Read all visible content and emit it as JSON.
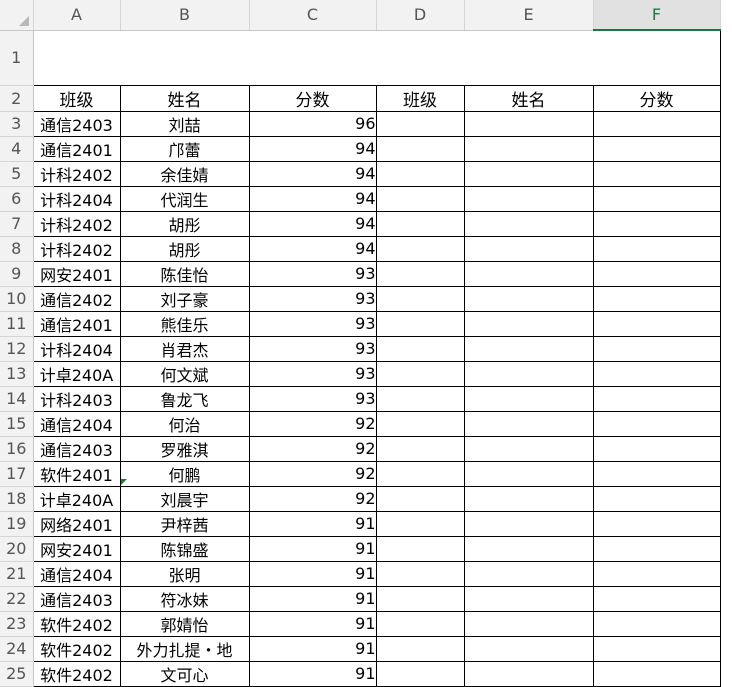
{
  "columns": [
    "A",
    "B",
    "C",
    "D",
    "E",
    "F"
  ],
  "row_numbers": [
    "1",
    "2",
    "3",
    "4",
    "5",
    "6",
    "7",
    "8",
    "9",
    "10",
    "11",
    "12",
    "13",
    "14",
    "15",
    "16",
    "17",
    "18",
    "19",
    "20",
    "21",
    "22",
    "23",
    "24",
    "25"
  ],
  "headers": {
    "class1": "班级",
    "name1": "姓名",
    "score1": "分数",
    "class2": "班级",
    "name2": "姓名",
    "score2": "分数"
  },
  "rows": [
    {
      "cls": "通信2403",
      "name": "刘喆",
      "score": "96"
    },
    {
      "cls": "通信2401",
      "name": "邝蕾",
      "score": "94"
    },
    {
      "cls": "计科2402",
      "name": "余佳婧",
      "score": "94"
    },
    {
      "cls": "计科2404",
      "name": "代润生",
      "score": "94"
    },
    {
      "cls": "计科2402",
      "name": "胡彤",
      "score": "94"
    },
    {
      "cls": "计科2402",
      "name": "胡彤",
      "score": "94"
    },
    {
      "cls": "网安2401",
      "name": "陈佳怡",
      "score": "93"
    },
    {
      "cls": "通信2402",
      "name": "刘子豪",
      "score": "93"
    },
    {
      "cls": "通信2401",
      "name": "熊佳乐",
      "score": "93"
    },
    {
      "cls": "计科2404",
      "name": "肖君杰",
      "score": "93"
    },
    {
      "cls": "计卓240A",
      "name": "何文斌",
      "score": "93"
    },
    {
      "cls": "计科2403",
      "name": "鲁龙飞",
      "score": "93"
    },
    {
      "cls": "通信2404",
      "name": "何治",
      "score": "92"
    },
    {
      "cls": "通信2403",
      "name": "罗雅淇",
      "score": "92"
    },
    {
      "cls": "软件2401",
      "name": "何鹏",
      "score": "92"
    },
    {
      "cls": "计卓240A",
      "name": "刘晨宇",
      "score": "92"
    },
    {
      "cls": "网络2401",
      "name": "尹梓茜",
      "score": "91"
    },
    {
      "cls": "网安2401",
      "name": "陈锦盛",
      "score": "91"
    },
    {
      "cls": "通信2404",
      "name": "张明",
      "score": "91"
    },
    {
      "cls": "通信2403",
      "name": "符冰妹",
      "score": "91"
    },
    {
      "cls": "软件2402",
      "name": "郭婧怡",
      "score": "91"
    },
    {
      "cls": "软件2402",
      "name": "外力扎提・地",
      "score": "91"
    },
    {
      "cls": "软件2402",
      "name": "文可心",
      "score": "91"
    }
  ],
  "selected_column": "F",
  "colors": {
    "accent": "#217346",
    "header_bg": "#f2f2f2",
    "grid": "#000000"
  }
}
